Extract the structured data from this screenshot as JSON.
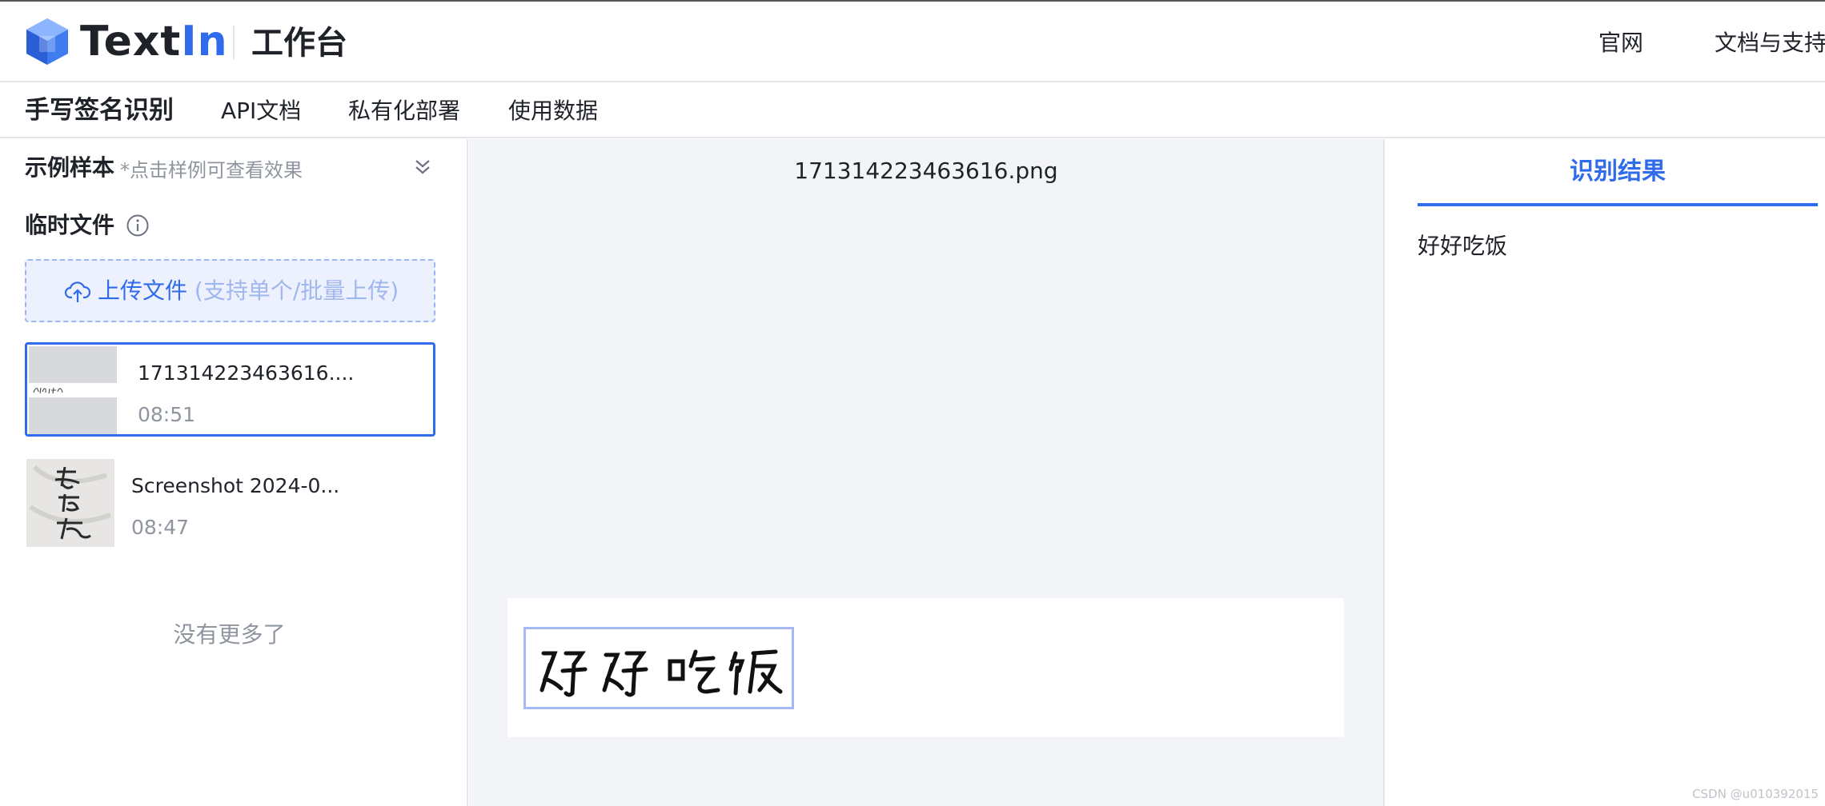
{
  "header": {
    "logo_text_a": "Text",
    "logo_text_b": "In",
    "workbench": "工作台",
    "links": [
      "官网",
      "文档与支持"
    ]
  },
  "subnav": {
    "title": "手写签名识别",
    "items": [
      "API文档",
      "私有化部署",
      "使用数据"
    ]
  },
  "left": {
    "sample_title": "示例样本",
    "sample_hint": "*点击样例可查看效果",
    "temp_title": "临时文件",
    "upload_label": "上传文件",
    "upload_sub": "(支持单个/批量上传)",
    "files": [
      {
        "name": "171314223463616....",
        "time": "08:51",
        "active": true
      },
      {
        "name": "Screenshot 2024-0...",
        "time": "08:47",
        "active": false
      }
    ],
    "no_more": "没有更多了"
  },
  "preview": {
    "file_name": "171314223463616.png",
    "signature_text": "好好吃饭"
  },
  "result": {
    "tab_label": "识别结果",
    "text": "好好吃饭"
  },
  "watermark": "CSDN @u010392015",
  "colors": {
    "accent": "#2f6bea",
    "border": "#e5e6eb",
    "preview_bg": "#f3f4f7"
  }
}
